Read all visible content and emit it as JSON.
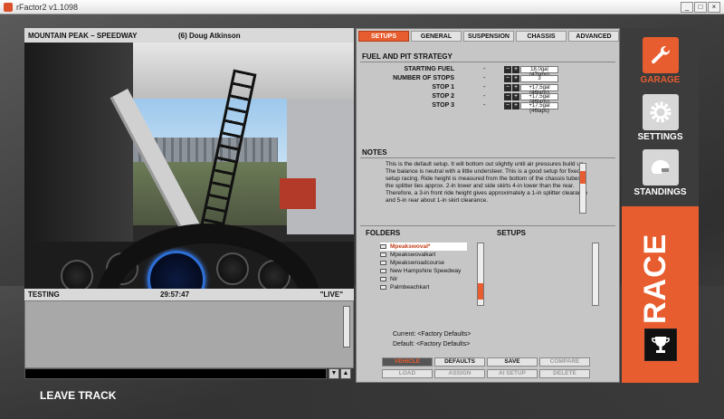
{
  "window": {
    "title": "rFactor2 v1.1098",
    "minimize": "_",
    "maximize": "□",
    "close": "×"
  },
  "camera_header": {
    "track": "MOUNTAIN PEAK – SPEEDWAY",
    "driver": "(6) Doug Atkinson"
  },
  "session": {
    "name": "TESTING",
    "time": "29:57:47",
    "status": "\"LIVE\""
  },
  "chat": {
    "up": "▲",
    "down": "▼"
  },
  "leave_track": "LEAVE TRACK",
  "tabs": [
    "SETUPS",
    "GENERAL",
    "SUSPENSION",
    "CHASSIS",
    "ADVANCED"
  ],
  "strategy": {
    "title": "FUEL AND PIT STRATEGY",
    "rows": [
      {
        "label": "STARTING FUEL",
        "value": "18.0gal (47laps)"
      },
      {
        "label": "NUMBER OF STOPS",
        "value": "3"
      },
      {
        "label": "STOP 1",
        "value": "+17.5gal (46laps)"
      },
      {
        "label": "STOP 2",
        "value": "+17.5gal (46laps)"
      },
      {
        "label": "STOP 3",
        "value": "+17.5gal (46laps)"
      }
    ],
    "dash": "-",
    "minus": "−",
    "plus": "+"
  },
  "notes": {
    "title": "NOTES",
    "text": "This is the default setup. It will bottom out slightly until air pressures build up. The balance is neutral with a little understeer. This is a good setup for fixed setup racing. Ride height is measured from the bottom of the chassis tubes, the splitter lies approx. 2-in lower and side skirts 4-in lower than the rear. Therefore, a 3-in front ride height gives approximately a 1-in splitter clearance and 5-in rear about 1-in skirt clearance."
  },
  "folders": {
    "title": "FOLDERS",
    "setups_title": "SETUPS",
    "items": [
      "Mpeakswoval*",
      "Mpeakswovalkart",
      "Mpeakswroadcourse",
      "New Hampshire Speedway",
      "Nir",
      "Palmbeachkart"
    ]
  },
  "current": "Current: <Factory Defaults>",
  "default": "Default: <Factory Defaults>",
  "buttons": [
    "VEHICLE",
    "DEFAULTS",
    "SAVE",
    "COMPARE",
    "LOAD",
    "ASSIGN",
    "AI SETUP",
    "DELETE"
  ],
  "nav": {
    "garage": "GARAGE",
    "settings": "SETTINGS",
    "standings": "STANDINGS",
    "race": "RACE"
  },
  "colors": {
    "accent": "#e85d2f",
    "panel": "#c6c6c6",
    "dark": "#3c3c3c"
  }
}
